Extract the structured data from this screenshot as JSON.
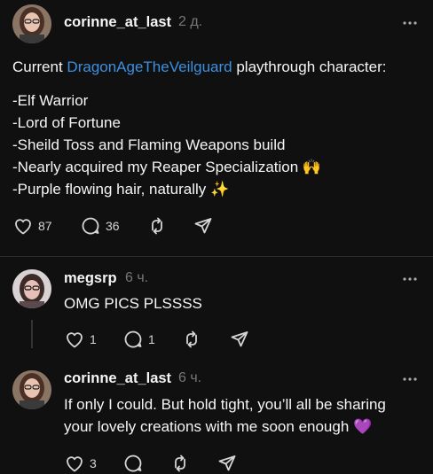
{
  "post": {
    "username": "corinne_at_last",
    "time": "2 д.",
    "text_intro": "Current ",
    "tag": "DragonAgeTheVeilguard",
    "text_after_tag": " playthrough character:",
    "lines": [
      "-Elf Warrior",
      "-Lord of Fortune",
      "-Sheild Toss and Flaming Weapons build",
      "-Nearly acquired my Reaper Specialization 🙌",
      "-Purple flowing hair, naturally ✨"
    ],
    "likes": "87",
    "replies": "36"
  },
  "reply1": {
    "username": "megsrp",
    "time": "6 ч.",
    "text": "OMG PICS PLSSSS",
    "likes": "1",
    "replies": "1"
  },
  "reply2": {
    "username": "corinne_at_last",
    "time": "6 ч.",
    "lines": [
      "If only I could. But hold tight, you’ll all be sharing",
      "your lovely creations with me soon enough 💜"
    ],
    "likes": "3"
  },
  "icons": {
    "like": "heart-icon",
    "reply": "speech-bubble-icon",
    "repost": "repost-icon",
    "share": "send-icon",
    "more": "more-dots-icon"
  },
  "colors": {
    "background": "#101010",
    "text": "#f3f5f7",
    "muted": "#777777",
    "link": "#3d8fe0"
  }
}
